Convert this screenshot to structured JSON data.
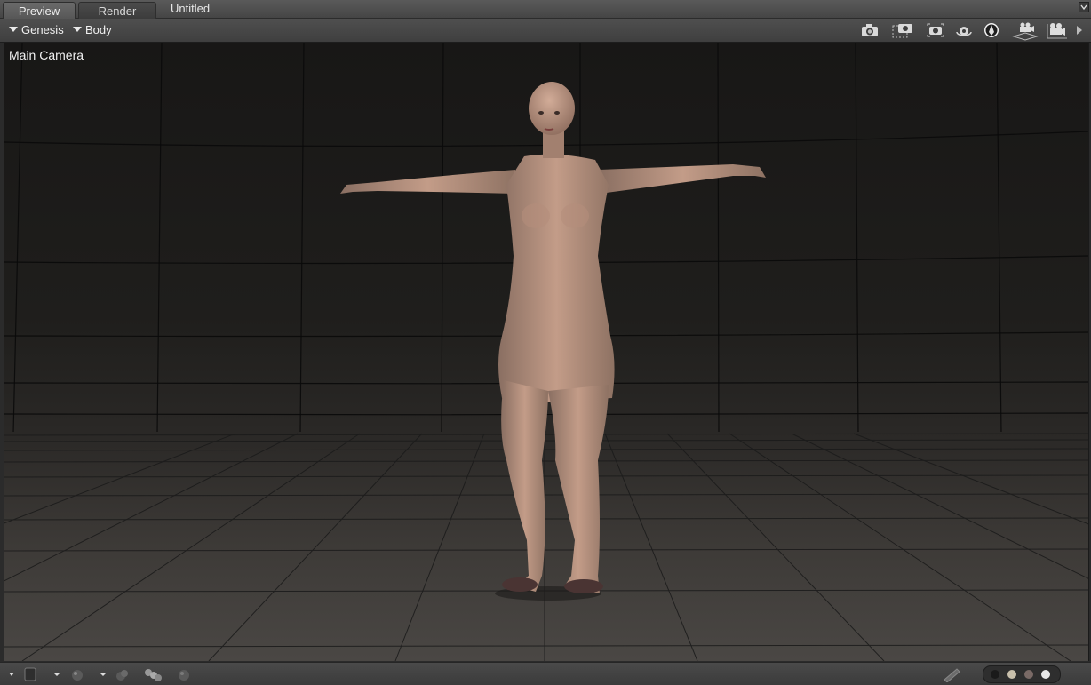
{
  "tabs": [
    {
      "label": "Preview",
      "active": true
    },
    {
      "label": "Render",
      "active": false
    }
  ],
  "document_title": "Untitled",
  "toolbar": {
    "scene_dropdown": "Genesis",
    "node_dropdown": "Body",
    "icons": [
      "camera-icon",
      "camera-frame-icon",
      "camera-select-icon",
      "orbit-icon",
      "perspective-icon",
      "camera-view-icon",
      "video-camera-icon",
      "more-arrow-icon"
    ]
  },
  "viewport": {
    "camera_label": "Main Camera"
  },
  "bottombar": {
    "swatch_colors": [
      "#1a1a1a",
      "#c9c0ac",
      "#7a6a66",
      "#e8e8e8"
    ]
  },
  "colors": {
    "accent": "#e6e6e6",
    "floor": "#3d3a37",
    "backdrop": "#151414"
  }
}
